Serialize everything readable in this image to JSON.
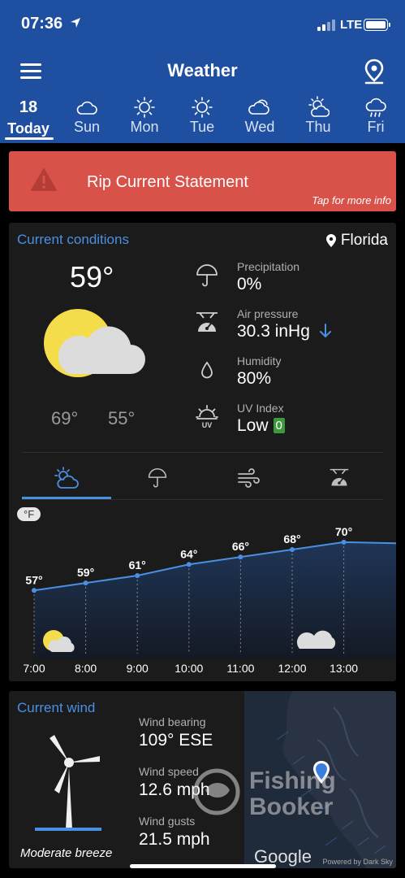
{
  "status_bar": {
    "time": "07:36",
    "network": "LTE"
  },
  "header": {
    "title": "Weather"
  },
  "days": [
    {
      "date": "18",
      "label": "Today",
      "icon": "none"
    },
    {
      "label": "Sun",
      "icon": "cloud-icon"
    },
    {
      "label": "Mon",
      "icon": "sun-icon"
    },
    {
      "label": "Tue",
      "icon": "sun-icon"
    },
    {
      "label": "Wed",
      "icon": "cloudy-icon"
    },
    {
      "label": "Thu",
      "icon": "partly-sunny-icon"
    },
    {
      "label": "Fri",
      "icon": "rain-icon"
    }
  ],
  "alert": {
    "title": "Rip Current Statement",
    "hint": "Tap for more info"
  },
  "current_conditions": {
    "title": "Current conditions",
    "location": "Florida",
    "temperature": "59°",
    "high": "69°",
    "low": "55°",
    "precipitation": {
      "label": "Precipitation",
      "value": "0%"
    },
    "air_pressure": {
      "label": "Air pressure",
      "value": "30.3 inHg"
    },
    "humidity": {
      "label": "Humidity",
      "value": "80%"
    },
    "uv_index": {
      "label": "UV Index",
      "value": "Low",
      "badge": "0"
    },
    "unit": "°F"
  },
  "chart_data": {
    "type": "line",
    "x": [
      "7:00",
      "8:00",
      "9:00",
      "10:00",
      "11:00",
      "12:00",
      "13:00"
    ],
    "values": [
      57,
      59,
      61,
      64,
      66,
      68,
      70
    ],
    "labels": [
      "57°",
      "59°",
      "61°",
      "64°",
      "66°",
      "68°",
      "70°"
    ],
    "ylim": [
      40,
      75
    ],
    "line_color": "#4a90e2"
  },
  "current_wind": {
    "title": "Current wind",
    "bearing": {
      "label": "Wind bearing",
      "value": "109° ESE"
    },
    "speed": {
      "label": "Wind speed",
      "value": "12.6 mph"
    },
    "gusts": {
      "label": "Wind gusts",
      "value": "21.5 mph"
    },
    "description": "Moderate breeze",
    "watermark_line1": "Fishing",
    "watermark_line2": "Booker",
    "map_brand": "Google",
    "credit": "Powered by Dark Sky"
  },
  "colors": {
    "header": "#1e4fa0",
    "alert": "#d9524a",
    "accent": "#4a90e2",
    "card": "#1b1b1b"
  }
}
